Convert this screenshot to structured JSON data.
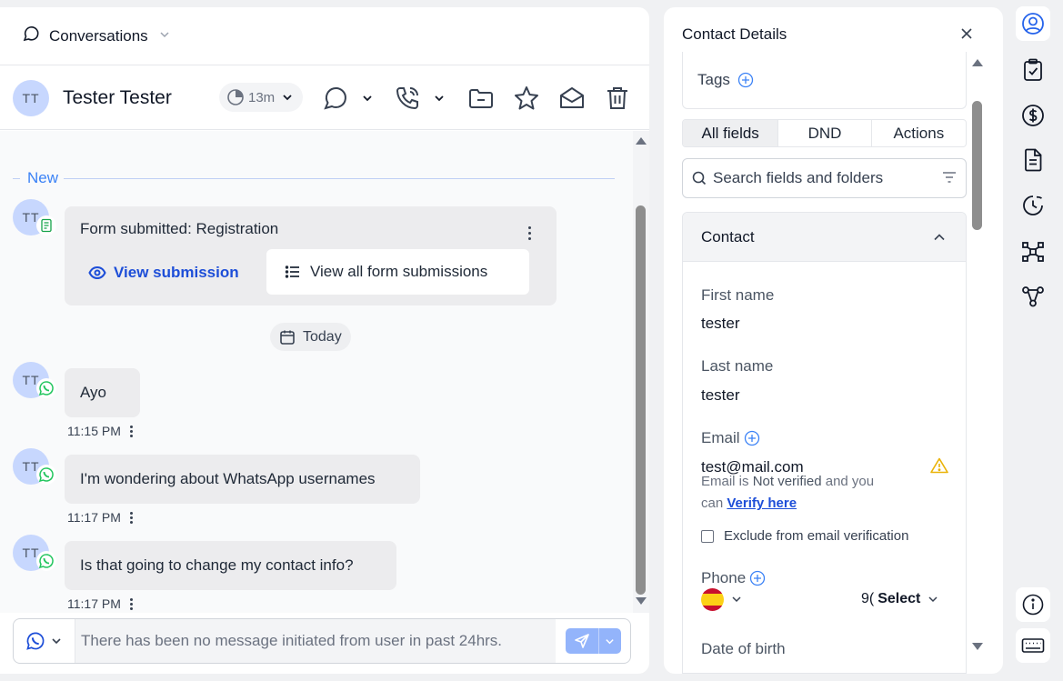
{
  "topbar": {
    "title": "Conversations"
  },
  "contact": {
    "initials": "TT",
    "name": "Tester Tester",
    "timer": "13m"
  },
  "chat": {
    "new_label": "New",
    "form_card": {
      "title": "Form submitted: Registration",
      "view_submission": "View submission",
      "view_all": "View all form submissions"
    },
    "date_chip": "Today",
    "messages": [
      {
        "text": "Ayo",
        "time": "11:15 PM"
      },
      {
        "text": "I'm wondering about WhatsApp usernames",
        "time": "11:17 PM"
      },
      {
        "text": "Is that going to change my contact info?",
        "time": "11:17 PM"
      }
    ]
  },
  "composer": {
    "placeholder": "There has been no message initiated from user in past 24hrs."
  },
  "details": {
    "title": "Contact Details",
    "tags_label": "Tags",
    "tabs": [
      "All fields",
      "DND",
      "Actions"
    ],
    "search_placeholder": "Search fields and folders",
    "section_title": "Contact",
    "first_name_label": "First name",
    "first_name_value": "tester",
    "last_name_label": "Last name",
    "last_name_value": "tester",
    "email_label": "Email",
    "email_value": "test@mail.com",
    "email_note_1": "Email is",
    "email_note_bold": "Not verified",
    "email_note_2": "and you",
    "email_note_3": "can",
    "verify_link": "Verify here",
    "exclude_label": "Exclude from email verification",
    "phone_label": "Phone",
    "phone_code": "9(",
    "phone_select": "Select",
    "dob_label": "Date of birth"
  },
  "colors": {
    "accent": "#1d4ed8",
    "whatsapp": "#22c55e",
    "warning": "#eab308",
    "send": "#93b4fb"
  },
  "icons": [
    "chat-icon",
    "clock-icon",
    "phone-icon",
    "folder-icon",
    "star-icon",
    "mail-icon",
    "trash-icon",
    "eye-icon",
    "list-icon",
    "calendar-icon",
    "whatsapp-icon",
    "send-icon",
    "user-icon",
    "tasks-icon",
    "dollar-icon",
    "document-icon",
    "history-icon",
    "network-icon",
    "workflow-icon",
    "info-icon",
    "keyboard-icon"
  ]
}
